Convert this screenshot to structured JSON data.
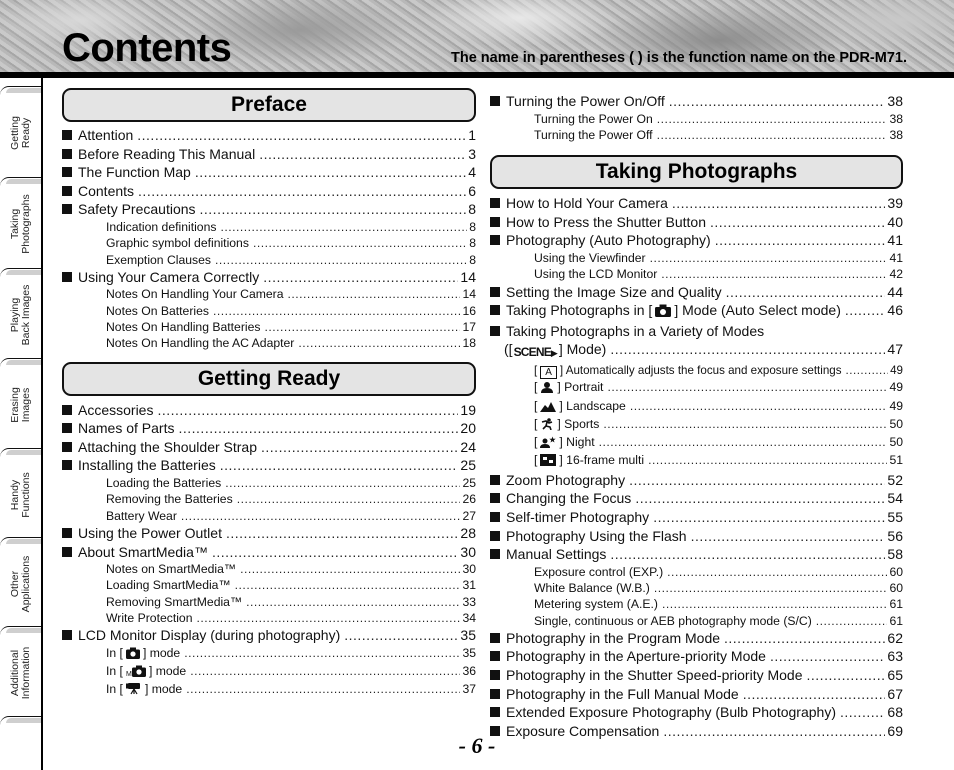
{
  "header": {
    "title": "Contents",
    "note": "The name in parentheses ( ) is the function name on the PDR-M71."
  },
  "side_tabs": [
    {
      "line1": "Getting",
      "line2": "Ready"
    },
    {
      "line1": "Taking",
      "line2": "Photographs"
    },
    {
      "line1": "Playing",
      "line2": "Back Images"
    },
    {
      "line1": "Erasing",
      "line2": "Images"
    },
    {
      "line1": "Handy",
      "line2": "Functions"
    },
    {
      "line1": "Other",
      "line2": "Applications"
    },
    {
      "line1": "Additional",
      "line2": "Information"
    }
  ],
  "preface": {
    "title": "Preface",
    "entries": [
      {
        "label": "Attention",
        "page": "1"
      },
      {
        "label": "Before Reading This Manual",
        "page": "3"
      },
      {
        "label": "The Function Map",
        "page": "4"
      },
      {
        "label": "Contents",
        "page": "6"
      },
      {
        "label": "Safety Precautions",
        "page": "8"
      },
      {
        "label": "Indication definitions",
        "page": "8"
      },
      {
        "label": "Graphic symbol definitions",
        "page": "8"
      },
      {
        "label": "Exemption Clauses",
        "page": "8"
      },
      {
        "label": "Using Your Camera Correctly",
        "page": "14"
      },
      {
        "label": "Notes On Handling Your Camera",
        "page": "14"
      },
      {
        "label": "Notes On Batteries",
        "page": "16"
      },
      {
        "label": "Notes On Handling Batteries",
        "page": "17"
      },
      {
        "label": "Notes On Handling the AC Adapter",
        "page": "18"
      }
    ]
  },
  "getting_ready": {
    "title": "Getting Ready",
    "entries": [
      {
        "label": "Accessories",
        "page": "19"
      },
      {
        "label": "Names of Parts",
        "page": "20"
      },
      {
        "label": "Attaching the Shoulder Strap",
        "page": "24"
      },
      {
        "label": "Installing the Batteries",
        "page": "25"
      },
      {
        "label": "Loading the Batteries",
        "page": "25"
      },
      {
        "label": "Removing the Batteries",
        "page": "26"
      },
      {
        "label": "Battery Wear",
        "page": "27"
      },
      {
        "label": "Using the Power Outlet",
        "page": "28"
      },
      {
        "label": "About SmartMedia™",
        "page": "30"
      },
      {
        "label": "Notes on SmartMedia™",
        "page": "30"
      },
      {
        "label": "Loading SmartMedia™",
        "page": "31"
      },
      {
        "label": "Removing SmartMedia™",
        "page": "33"
      },
      {
        "label": "Write Protection",
        "page": "34"
      },
      {
        "label": "LCD Monitor Display (during photography)",
        "page": "35"
      },
      {
        "prefix": "In [",
        "icon": "camera-icon",
        "suffix": "] mode",
        "page": "35"
      },
      {
        "prefix": "In [",
        "icon": "manual-camera-icon",
        "suffix": "] mode",
        "page": "36"
      },
      {
        "prefix": "In [",
        "icon": "movie-camera-icon",
        "suffix": "] mode",
        "page": "37"
      },
      {
        "label": "Turning the Power On/Off",
        "page": "38"
      },
      {
        "label": "Turning the Power On",
        "page": "38"
      },
      {
        "label": "Turning the Power Off",
        "page": "38"
      }
    ]
  },
  "taking_photographs": {
    "title": "Taking Photographs",
    "entries": [
      {
        "label": "How to Hold Your Camera",
        "page": "39"
      },
      {
        "label": "How to Press the Shutter Button",
        "page": "40"
      },
      {
        "label": "Photography (Auto Photography)",
        "page": "41"
      },
      {
        "label": "Using the Viewfinder",
        "page": "41"
      },
      {
        "label": "Using the LCD Monitor",
        "page": "42"
      },
      {
        "label": "Setting the Image Size and Quality",
        "page": "44"
      },
      {
        "prefix": "Taking Photographs in [",
        "icon": "camera-icon",
        "suffix": "] Mode (Auto Select mode)",
        "page": "46"
      },
      {
        "label": "Taking Photographs in a Variety of Modes",
        "page": ""
      },
      {
        "prefix": "([",
        "icon": "scene-icon",
        "icon_text": "SCENE",
        "suffix": "] Mode)",
        "page": "47"
      },
      {
        "prefix": "[",
        "icon": "auto-mode-icon",
        "icon_text": "A",
        "suffix": "] Automatically adjusts the focus and exposure settings",
        "page": "49"
      },
      {
        "prefix": "[",
        "icon": "portrait-icon",
        "suffix": "] Portrait",
        "page": "49"
      },
      {
        "prefix": "[",
        "icon": "landscape-icon",
        "suffix": "] Landscape",
        "page": "49"
      },
      {
        "prefix": "[",
        "icon": "sports-icon",
        "suffix": "] Sports",
        "page": "50"
      },
      {
        "prefix": "[",
        "icon": "night-icon",
        "suffix": "] Night",
        "page": "50"
      },
      {
        "prefix": "[",
        "icon": "multi-frame-icon",
        "suffix": "] 16-frame multi",
        "page": "51"
      },
      {
        "label": "Zoom Photography",
        "page": "52"
      },
      {
        "label": "Changing the Focus",
        "page": "54"
      },
      {
        "label": "Self-timer Photography",
        "page": "55"
      },
      {
        "label": "Photography Using the Flash",
        "page": "56"
      },
      {
        "label": "Manual Settings",
        "page": "58"
      },
      {
        "label": "Exposure control (EXP.)",
        "page": "60"
      },
      {
        "label": "White Balance (W.B.)",
        "page": "60"
      },
      {
        "label": "Metering system (A.E.)",
        "page": "61"
      },
      {
        "label": "Single, continuous or AEB photography mode (S/C)",
        "page": "61"
      },
      {
        "label": "Photography in the Program Mode",
        "page": "62"
      },
      {
        "label": "Photography in the Aperture-priority Mode",
        "page": "63"
      },
      {
        "label": "Photography in the Shutter Speed-priority Mode",
        "page": "65"
      },
      {
        "label": "Photography in the Full Manual Mode",
        "page": "67"
      },
      {
        "label": "Extended Exposure Photography (Bulb Photography)",
        "page": "68"
      },
      {
        "label": "Exposure Compensation",
        "page": "69"
      }
    ]
  },
  "footer": {
    "page_number": "- 6 -"
  }
}
